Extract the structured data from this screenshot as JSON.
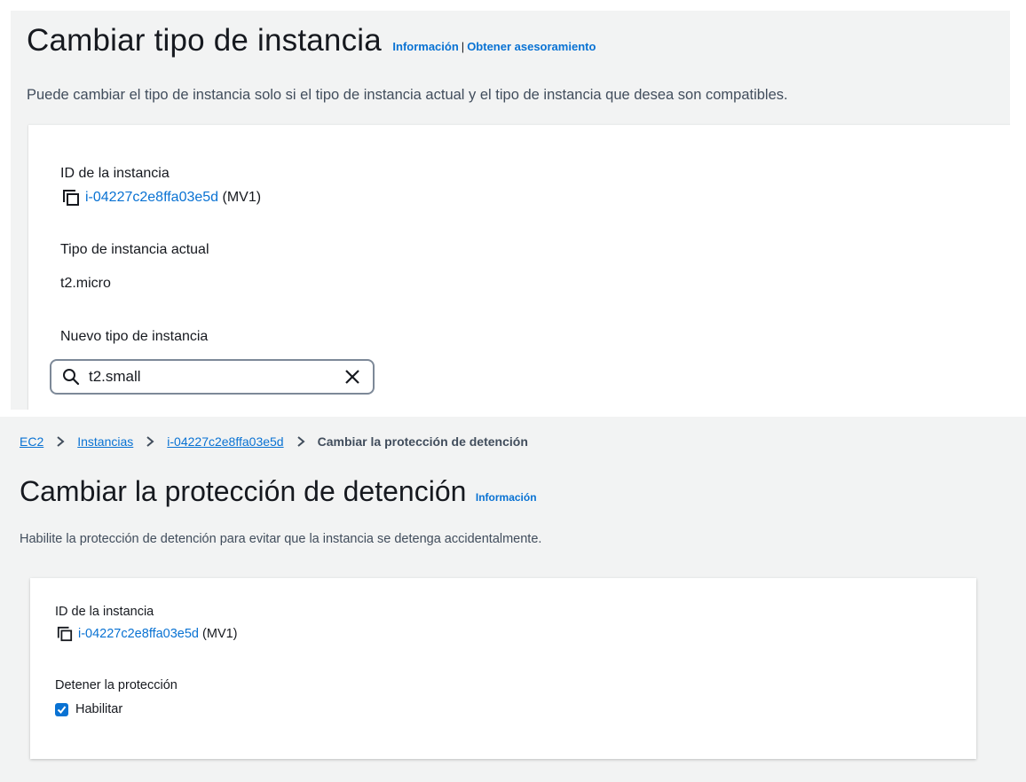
{
  "change_type": {
    "title": "Cambiar tipo de instancia",
    "info_link": "Información",
    "separator": "|",
    "advice_link": "Obtener asesoramiento",
    "description": "Puede cambiar el tipo de instancia solo si el tipo de instancia actual y el tipo de instancia que desea son compatibles.",
    "instance_id_label": "ID de la instancia",
    "instance_id": "i-04227c2e8ffa03e5d",
    "instance_name": "(MV1)",
    "current_type_label": "Tipo de instancia actual",
    "current_type": "t2.micro",
    "new_type_label": "Nuevo tipo de instancia",
    "new_type_value": "t2.small"
  },
  "stop_protection": {
    "breadcrumb": [
      "EC2",
      "Instancias",
      "i-04227c2e8ffa03e5d"
    ],
    "breadcrumb_current": "Cambiar la protección de detención",
    "title": "Cambiar la protección de detención",
    "info_link": "Información",
    "description": "Habilite la protección de detención para evitar que la instancia se detenga accidentalmente.",
    "instance_id_label": "ID de la instancia",
    "instance_id": "i-04227c2e8ffa03e5d",
    "instance_name": "(MV1)",
    "protection_label": "Detener la protección",
    "checkbox_label": "Habilitar",
    "checkbox_checked": true
  },
  "colors": {
    "link": "#0972d3",
    "panel_bg": "#f2f3f3",
    "text": "#16191f"
  },
  "icons": [
    "copy-icon",
    "search-icon",
    "clear-icon",
    "chevron-right-icon",
    "checkmark-icon"
  ]
}
